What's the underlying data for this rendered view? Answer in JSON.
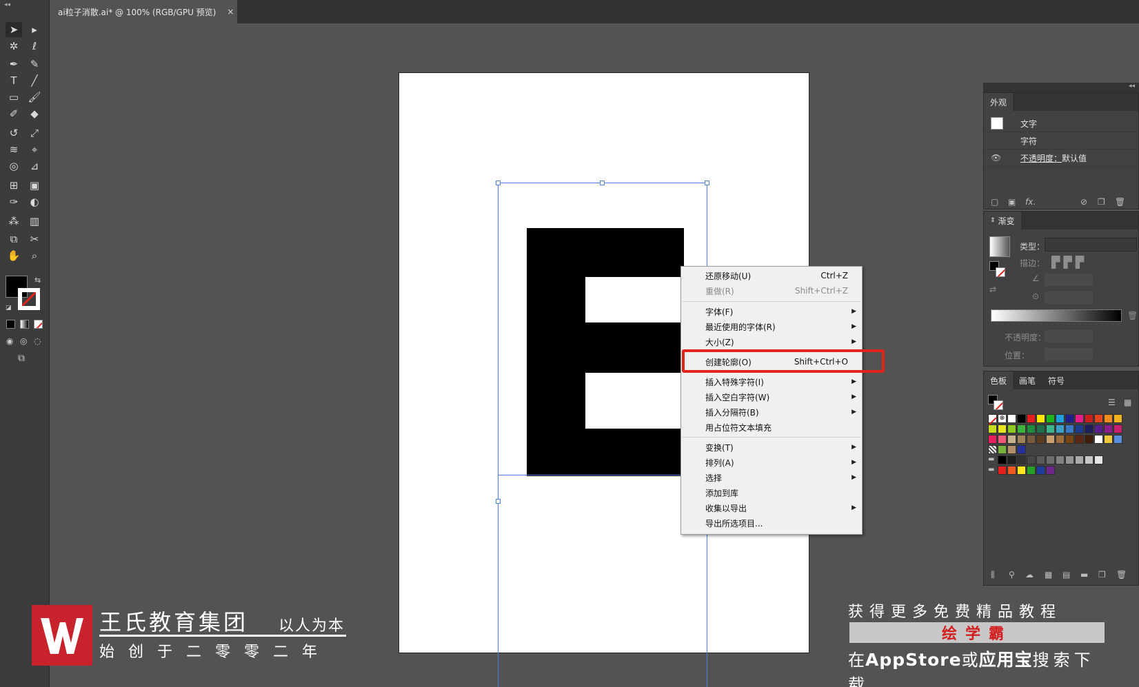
{
  "document_tab": {
    "title": "ai粒子消散.ai* @ 100% (RGB/GPU 预览)",
    "close": "×"
  },
  "toolbar": {
    "icons": [
      "selection-tool",
      "direct-selection-tool",
      "magic-wand-tool",
      "lasso-tool",
      "pen-tool",
      "curvature-tool",
      "type-tool",
      "line-segment-tool",
      "rectangle-tool",
      "paintbrush-tool",
      "shaper-tool",
      "eraser-tool",
      "rotate-tool",
      "scale-tool",
      "warp-tool",
      "free-transform-tool",
      "shape-builder-tool",
      "perspective-grid-tool",
      "mesh-tool",
      "gradient-tool",
      "eyedropper-tool",
      "blend-tool",
      "symbol-sprayer-tool",
      "column-graph-tool",
      "artboard-tool",
      "slice-tool",
      "hand-tool",
      "zoom-tool"
    ],
    "fill_color": "#000000",
    "stroke": "none"
  },
  "context_menu": {
    "items": [
      {
        "label": "还原移动(U)",
        "shortcut": "Ctrl+Z",
        "enabled": true,
        "submenu": false
      },
      {
        "label": "重做(R)",
        "shortcut": "Shift+Ctrl+Z",
        "enabled": false,
        "submenu": false
      },
      {
        "label": "字体(F)",
        "shortcut": "",
        "enabled": true,
        "submenu": true
      },
      {
        "label": "最近使用的字体(R)",
        "shortcut": "",
        "enabled": true,
        "submenu": true
      },
      {
        "label": "大小(Z)",
        "shortcut": "",
        "enabled": true,
        "submenu": true
      },
      {
        "label": "创建轮廓(O)",
        "shortcut": "Shift+Ctrl+O",
        "enabled": true,
        "submenu": false,
        "highlighted": true
      },
      {
        "label": "插入特殊字符(I)",
        "shortcut": "",
        "enabled": true,
        "submenu": true
      },
      {
        "label": "插入空白字符(W)",
        "shortcut": "",
        "enabled": true,
        "submenu": true
      },
      {
        "label": "插入分隔符(B)",
        "shortcut": "",
        "enabled": true,
        "submenu": true
      },
      {
        "label": "用占位符文本填充",
        "shortcut": "",
        "enabled": true,
        "submenu": false
      },
      {
        "label": "变换(T)",
        "shortcut": "",
        "enabled": true,
        "submenu": true
      },
      {
        "label": "排列(A)",
        "shortcut": "",
        "enabled": true,
        "submenu": true
      },
      {
        "label": "选择",
        "shortcut": "",
        "enabled": true,
        "submenu": true
      },
      {
        "label": "添加到库",
        "shortcut": "",
        "enabled": true,
        "submenu": false
      },
      {
        "label": "收集以导出",
        "shortcut": "",
        "enabled": true,
        "submenu": true
      },
      {
        "label": "导出所选项目...",
        "shortcut": "",
        "enabled": true,
        "submenu": false
      }
    ],
    "highlight_color": "#e2231a"
  },
  "appearance_panel": {
    "tab": "外观",
    "rows": [
      "文字",
      "字符"
    ],
    "opacity_label": "不透明度：",
    "opacity_value": "默认值",
    "footer_fx": "fx."
  },
  "gradient_panel": {
    "tab": "渐变",
    "type_label": "类型：",
    "stroke_label": "描边：",
    "opacity_label": "不透明度：",
    "position_label": "位置："
  },
  "swatches_panel": {
    "tabs": [
      "色板",
      "画笔",
      "符号"
    ],
    "rows": [
      [
        "none",
        "reg",
        "#ffffff",
        "#000000",
        "#e61e1e",
        "#ffe600",
        "#1eb41e",
        "#1ea0dc",
        "#1e1e8c",
        "#e61e8c",
        "#c81e1e",
        "#e6461e",
        "#f08c1e",
        "#f0b41e"
      ],
      [
        "#c8dc1e",
        "#e6e61e",
        "#8cc81e",
        "#3cb43c",
        "#1e8c3c",
        "#1e6e46",
        "#3cb48c",
        "#3ca0c8",
        "#3c78c8",
        "#1e3c8c",
        "#1e1e5a",
        "#5a1e8c",
        "#8c1e8c",
        "#c81e6e"
      ],
      [
        "#e61e5a",
        "#f05a78",
        "#c8b48c",
        "#a0825a",
        "#785a3c",
        "#5a3c1e",
        "#c8a06e",
        "#a06e3c",
        "#784614",
        "#5a2814",
        "#3c1e0a",
        "#ffffff",
        "#f0c83c",
        "#5a8cdc"
      ],
      [
        "pattern",
        "#7ab33c",
        "#b4906a",
        "#28329a"
      ],
      [
        "folder",
        "#000000",
        "#1e1e1e",
        "#323232",
        "#464646",
        "#5a5a5a",
        "#6e6e6e",
        "#828282",
        "#969696",
        "#aaaaaa",
        "#c8c8c8",
        "#e6e6e6"
      ],
      [
        "folder",
        "#e61e1e",
        "#f05a1e",
        "#ffe61e",
        "#28a028",
        "#1e3c9a",
        "#6e288c"
      ]
    ]
  },
  "watermark_left": {
    "title": "王氏教育集团",
    "motto": "以人为本",
    "subtitle": "始创于二零零二年"
  },
  "watermark_right": {
    "line1": "获得更多免费精品教程",
    "line2": "绘学霸",
    "line3_prefix": "在",
    "line3_store": "AppStore",
    "line3_or": "或",
    "line3_app": "应用宝",
    "line3_suffix": "搜索下载"
  }
}
